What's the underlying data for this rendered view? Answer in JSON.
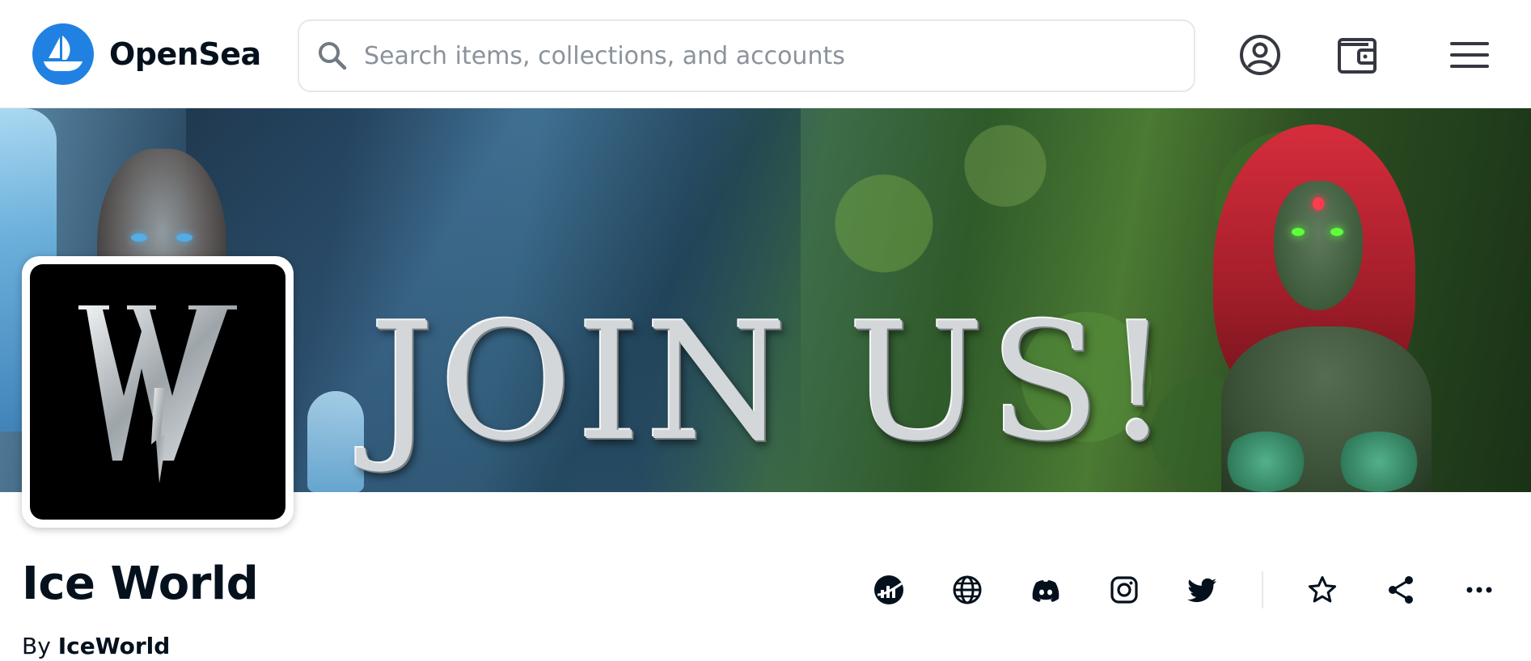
{
  "header": {
    "brand_name": "OpenSea",
    "logo_icon": "opensea-sailboat-icon",
    "search": {
      "placeholder": "Search items, collections, and accounts",
      "value": ""
    },
    "nav_icons": [
      "account-icon",
      "wallet-icon",
      "menu-icon"
    ]
  },
  "banner": {
    "headline": "JOIN US!"
  },
  "collection": {
    "title": "Ice World",
    "by_label": "By",
    "creator": "IceWorld",
    "avatar_monogram": "W",
    "action_icons": [
      "activity-chart-icon",
      "website-globe-icon",
      "discord-icon",
      "instagram-icon",
      "twitter-icon",
      "favorite-star-icon",
      "share-icon",
      "more-options-icon"
    ]
  },
  "colors": {
    "brand_blue": "#2081e2",
    "text_primary": "#04111d",
    "text_muted": "#8a939b",
    "border": "#e5e8eb"
  }
}
